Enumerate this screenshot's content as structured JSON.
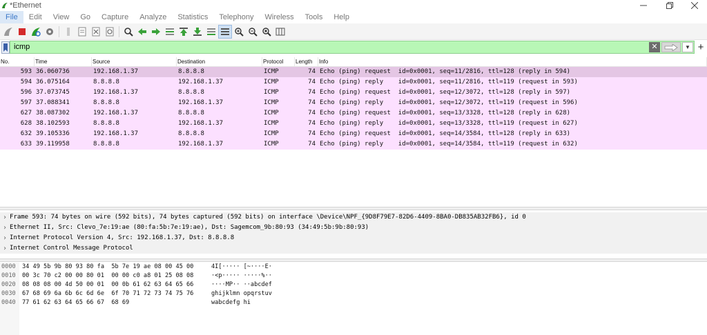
{
  "window": {
    "title": "*Ethernet",
    "brand_color": "#2c8c2c"
  },
  "menu": [
    {
      "label": "File",
      "active": true
    },
    {
      "label": "Edit"
    },
    {
      "label": "View"
    },
    {
      "label": "Go"
    },
    {
      "label": "Capture"
    },
    {
      "label": "Analyze"
    },
    {
      "label": "Statistics"
    },
    {
      "label": "Telephony"
    },
    {
      "label": "Wireless"
    },
    {
      "label": "Tools"
    },
    {
      "label": "Help"
    }
  ],
  "toolbar": {
    "icons": [
      "shark-fin-start-icon",
      "stop-capture-icon",
      "restart-capture-icon",
      "capture-options-icon",
      "open-file-icon",
      "save-file-icon",
      "close-file-icon",
      "reload-file-icon",
      "find-packet-icon",
      "go-back-icon",
      "go-forward-icon",
      "go-to-packet-icon",
      "go-first-packet-icon",
      "go-last-packet-icon",
      "auto-scroll-icon",
      "colorize-icon",
      "zoom-in-icon",
      "zoom-out-icon",
      "normal-size-icon",
      "resize-columns-icon"
    ]
  },
  "filter": {
    "value": "icmp",
    "background": "#b8f7b6"
  },
  "packet_list": {
    "columns": [
      "No.",
      "Time",
      "Source",
      "Destination",
      "Protocol",
      "Length",
      "Info"
    ],
    "rows": [
      {
        "no": "593",
        "time": "36.060736",
        "src": "192.168.1.37",
        "dst": "8.8.8.8",
        "proto": "ICMP",
        "len": "74",
        "info": "Echo (ping) request  id=0x0001, seq=11/2816, ttl=128 (reply in 594)",
        "selected": true
      },
      {
        "no": "594",
        "time": "36.075164",
        "src": "8.8.8.8",
        "dst": "192.168.1.37",
        "proto": "ICMP",
        "len": "74",
        "info": "Echo (ping) reply    id=0x0001, seq=11/2816, ttl=119 (request in 593)"
      },
      {
        "no": "596",
        "time": "37.073745",
        "src": "192.168.1.37",
        "dst": "8.8.8.8",
        "proto": "ICMP",
        "len": "74",
        "info": "Echo (ping) request  id=0x0001, seq=12/3072, ttl=128 (reply in 597)"
      },
      {
        "no": "597",
        "time": "37.088341",
        "src": "8.8.8.8",
        "dst": "192.168.1.37",
        "proto": "ICMP",
        "len": "74",
        "info": "Echo (ping) reply    id=0x0001, seq=12/3072, ttl=119 (request in 596)"
      },
      {
        "no": "627",
        "time": "38.087302",
        "src": "192.168.1.37",
        "dst": "8.8.8.8",
        "proto": "ICMP",
        "len": "74",
        "info": "Echo (ping) request  id=0x0001, seq=13/3328, ttl=128 (reply in 628)"
      },
      {
        "no": "628",
        "time": "38.102593",
        "src": "8.8.8.8",
        "dst": "192.168.1.37",
        "proto": "ICMP",
        "len": "74",
        "info": "Echo (ping) reply    id=0x0001, seq=13/3328, ttl=119 (request in 627)"
      },
      {
        "no": "632",
        "time": "39.105336",
        "src": "192.168.1.37",
        "dst": "8.8.8.8",
        "proto": "ICMP",
        "len": "74",
        "info": "Echo (ping) request  id=0x0001, seq=14/3584, ttl=128 (reply in 633)"
      },
      {
        "no": "633",
        "time": "39.119958",
        "src": "8.8.8.8",
        "dst": "192.168.1.37",
        "proto": "ICMP",
        "len": "74",
        "info": "Echo (ping) reply    id=0x0001, seq=14/3584, ttl=119 (request in 632)"
      }
    ],
    "row_color": "#fce0ff",
    "selected_color": "#e4c6e4"
  },
  "details": [
    "Frame 593: 74 bytes on wire (592 bits), 74 bytes captured (592 bits) on interface \\Device\\NPF_{9D8F79E7-82D6-4409-8BA0-DB835AB32FB6}, id 0",
    "Ethernet II, Src: Clevo_7e:19:ae (80:fa:5b:7e:19:ae), Dst: Sagemcom_9b:80:93 (34:49:5b:9b:80:93)",
    "Internet Protocol Version 4, Src: 192.168.1.37, Dst: 8.8.8.8",
    "Internet Control Message Protocol"
  ],
  "bytes": [
    {
      "offset": "0000",
      "hex": "34 49 5b 9b 80 93 80 fa  5b 7e 19 ae 08 00 45 00",
      "ascii": "4I[····· [~····E·"
    },
    {
      "offset": "0010",
      "hex": "00 3c 70 c2 00 00 80 01  00 00 c0 a8 01 25 08 08",
      "ascii": "·<p····· ·····%··"
    },
    {
      "offset": "0020",
      "hex": "08 08 08 00 4d 50 00 01  00 0b 61 62 63 64 65 66",
      "ascii": "····MP·· ··abcdef"
    },
    {
      "offset": "0030",
      "hex": "67 68 69 6a 6b 6c 6d 6e  6f 70 71 72 73 74 75 76",
      "ascii": "ghijklmn opqrstuv"
    },
    {
      "offset": "0040",
      "hex": "77 61 62 63 64 65 66 67  68 69",
      "ascii": "wabcdefg hi"
    }
  ]
}
